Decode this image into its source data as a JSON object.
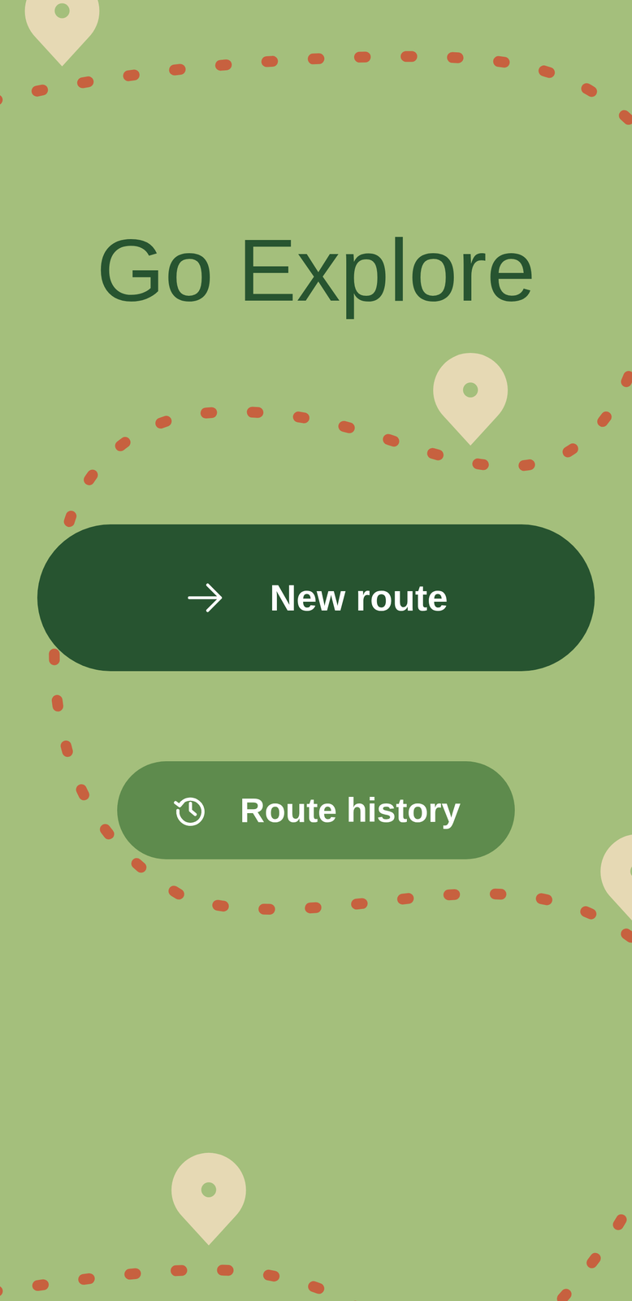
{
  "title": "Go Explore",
  "buttons": [
    {
      "label": "New route",
      "kind": "primary"
    },
    {
      "label": "Route history",
      "kind": "secondary"
    }
  ]
}
